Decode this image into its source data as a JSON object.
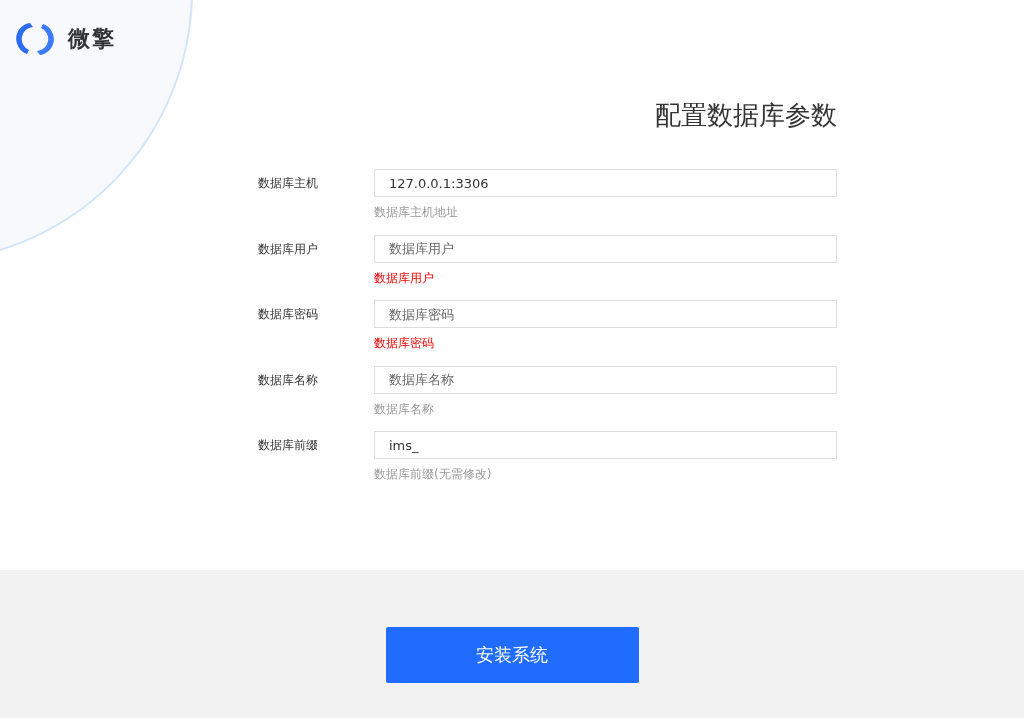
{
  "brand": {
    "name": "微擎"
  },
  "title": "配置数据库参数",
  "fields": [
    {
      "label": "数据库主机",
      "value": "127.0.0.1:3306",
      "hint": "数据库主机地址",
      "error": false
    },
    {
      "label": "数据库用户",
      "placeholder": "数据库用户",
      "hint": "数据库用户",
      "error": true
    },
    {
      "label": "数据库密码",
      "placeholder": "数据库密码",
      "hint": "数据库密码",
      "error": true
    },
    {
      "label": "数据库名称",
      "placeholder": "数据库名称",
      "hint": "数据库名称",
      "error": false
    },
    {
      "label": "数据库前缀",
      "value": "ims_",
      "hint": "数据库前缀(无需修改)",
      "error": false
    }
  ],
  "button": "安装系统"
}
